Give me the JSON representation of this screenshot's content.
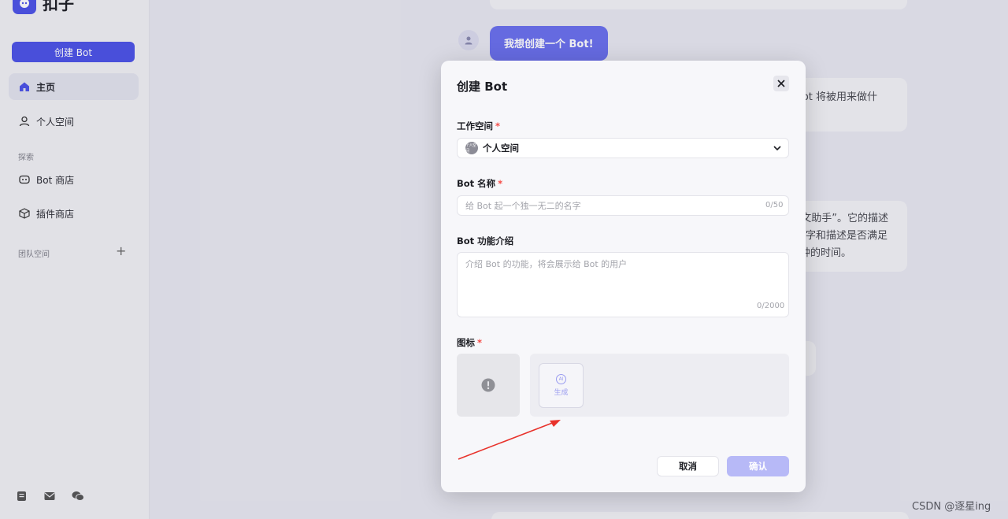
{
  "sidebar": {
    "brand": "扣子",
    "create_button": "创建 Bot",
    "nav": [
      {
        "label": "主页",
        "active": true
      },
      {
        "label": "个人空间",
        "active": false
      }
    ],
    "explore_label": "探索",
    "explore_items": [
      "Bot 商店",
      "插件商店"
    ],
    "team_label": "团队空间"
  },
  "chat": {
    "user_message": "我想创建一个 Bot!",
    "snippet_1": "ot 将被用来做什",
    "snippet_2_lines": [
      "文助手”。它的描述",
      "字和描述是否满足",
      "钟的时间。"
    ]
  },
  "modal": {
    "title": "创建 Bot",
    "workspace_label": "工作空间",
    "workspace_avatar_text": "个人空间",
    "workspace_value": "个人空间",
    "name_label": "Bot 名称",
    "name_placeholder": "给 Bot 起一个独一无二的名字",
    "name_counter": "0/50",
    "desc_label": "Bot 功能介绍",
    "desc_placeholder": "介绍 Bot 的功能，将会展示给 Bot 的用户",
    "desc_counter": "0/2000",
    "icon_label": "图标",
    "required_mark": "*",
    "ai_badge": "AI",
    "generate_label": "生成",
    "cancel_label": "取消",
    "confirm_label": "确认"
  },
  "watermark": "CSDN @逐星ing",
  "colors": {
    "accent": "#4d53e8",
    "confirm_disabled": "#b7b9f7",
    "required": "#f54a45",
    "annotation_arrow": "#e8322b"
  }
}
